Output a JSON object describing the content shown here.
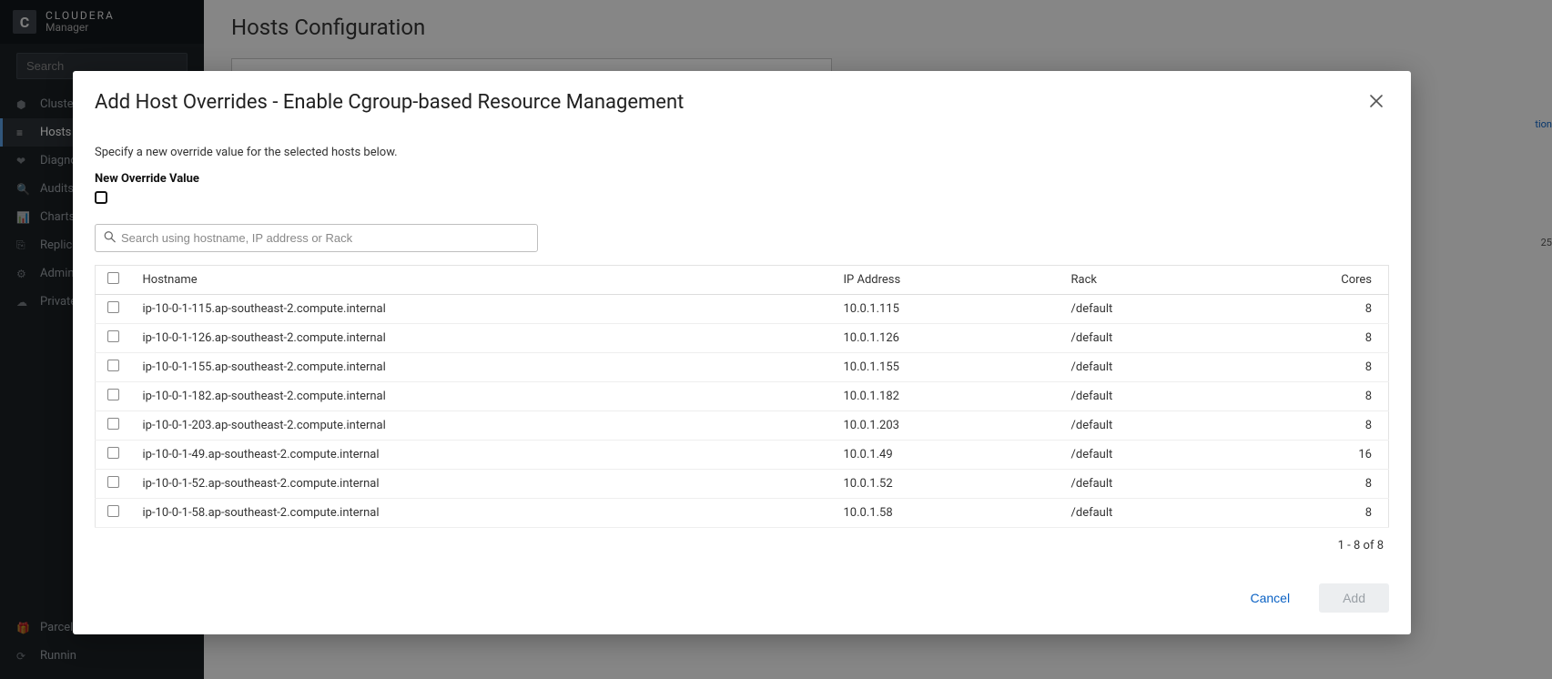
{
  "brand": {
    "logo_letter": "C",
    "line1": "CLOUDERA",
    "line2": "Manager"
  },
  "sidebar": {
    "search_placeholder": "Search",
    "items": [
      {
        "label": "Cluste",
        "icon": "⬢"
      },
      {
        "label": "Hosts",
        "icon": "≡",
        "active": true
      },
      {
        "label": "Diagno",
        "icon": "❤"
      },
      {
        "label": "Audits",
        "icon": "🔍"
      },
      {
        "label": "Charts",
        "icon": "📊"
      },
      {
        "label": "Replic",
        "icon": "⎘"
      },
      {
        "label": "Admini",
        "icon": "⚙"
      },
      {
        "label": "Private",
        "icon": "☁"
      }
    ],
    "bottom": [
      {
        "label": "Parcel",
        "icon": "🎁"
      },
      {
        "label": "Runnin",
        "icon": "⟳"
      }
    ]
  },
  "page": {
    "title": "Hosts Configuration",
    "right_link": "tion",
    "right_count": "25"
  },
  "modal": {
    "title": "Add Host Overrides - Enable Cgroup-based Resource Management",
    "description": "Specify a new override value for the selected hosts below.",
    "override_label": "New Override Value",
    "search_placeholder": "Search using hostname, IP address or Rack",
    "table": {
      "headers": {
        "hostname": "Hostname",
        "ip": "IP Address",
        "rack": "Rack",
        "cores": "Cores"
      },
      "rows": [
        {
          "hostname": "ip-10-0-1-115.ap-southeast-2.compute.internal",
          "ip": "10.0.1.115",
          "rack": "/default",
          "cores": "8"
        },
        {
          "hostname": "ip-10-0-1-126.ap-southeast-2.compute.internal",
          "ip": "10.0.1.126",
          "rack": "/default",
          "cores": "8"
        },
        {
          "hostname": "ip-10-0-1-155.ap-southeast-2.compute.internal",
          "ip": "10.0.1.155",
          "rack": "/default",
          "cores": "8"
        },
        {
          "hostname": "ip-10-0-1-182.ap-southeast-2.compute.internal",
          "ip": "10.0.1.182",
          "rack": "/default",
          "cores": "8"
        },
        {
          "hostname": "ip-10-0-1-203.ap-southeast-2.compute.internal",
          "ip": "10.0.1.203",
          "rack": "/default",
          "cores": "8"
        },
        {
          "hostname": "ip-10-0-1-49.ap-southeast-2.compute.internal",
          "ip": "10.0.1.49",
          "rack": "/default",
          "cores": "16"
        },
        {
          "hostname": "ip-10-0-1-52.ap-southeast-2.compute.internal",
          "ip": "10.0.1.52",
          "rack": "/default",
          "cores": "8"
        },
        {
          "hostname": "ip-10-0-1-58.ap-southeast-2.compute.internal",
          "ip": "10.0.1.58",
          "rack": "/default",
          "cores": "8"
        }
      ]
    },
    "pager": "1 - 8 of 8",
    "buttons": {
      "cancel": "Cancel",
      "add": "Add"
    }
  }
}
